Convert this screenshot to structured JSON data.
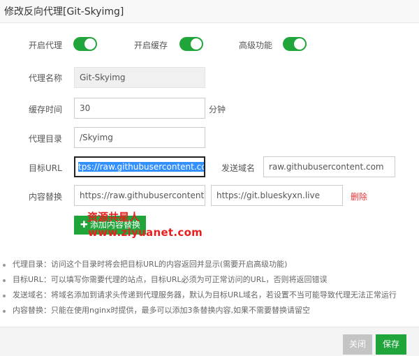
{
  "dialog": {
    "title": "修改反向代理[Git-Skyimg]"
  },
  "toggles": [
    {
      "label": "开启代理",
      "on": true
    },
    {
      "label": "开启缓存",
      "on": true
    },
    {
      "label": "高级功能",
      "on": true
    }
  ],
  "form": {
    "proxy_name_label": "代理名称",
    "proxy_name_value": "Git-Skyimg",
    "cache_time_label": "缓存时间",
    "cache_time_value": "30",
    "cache_time_unit": "分钟",
    "proxy_dir_label": "代理目录",
    "proxy_dir_value": "/Skyimg",
    "target_url_label": "目标URL",
    "target_url_value": "tps://raw.githubusercontent.com",
    "send_domain_label": "发送域名",
    "send_domain_value": "raw.githubusercontent.com",
    "replace_label": "内容替换",
    "replace_from_value": "https://raw.githubusercontent.con",
    "replace_to_value": "https://git.blueskyxn.live",
    "delete_label": "删除",
    "add_replace_label": "添加内容替换"
  },
  "watermark": {
    "line1": "资源共星人",
    "line2": "www.ziyuanet.com"
  },
  "notes": [
    "代理目录：访问这个目录时将会把目标URL的内容返回并显示(需要开启高级功能)",
    "目标URL：可以填写你需要代理的站点，目标URL必须为可正常访问的URL，否则将返回错误",
    "发送域名：将域名添加到请求头传递到代理服务器，默认为目标URL域名，若设置不当可能导致代理无法正常运行",
    "内容替换：只能在使用nginx时提供，最多可以添加3条替换内容,如果不需要替换请留空"
  ],
  "footer": {
    "close_label": "关闭",
    "save_label": "保存"
  },
  "colors": {
    "accent": "#20a53a",
    "danger": "#e33333",
    "disabled": "#c4c4c4"
  }
}
